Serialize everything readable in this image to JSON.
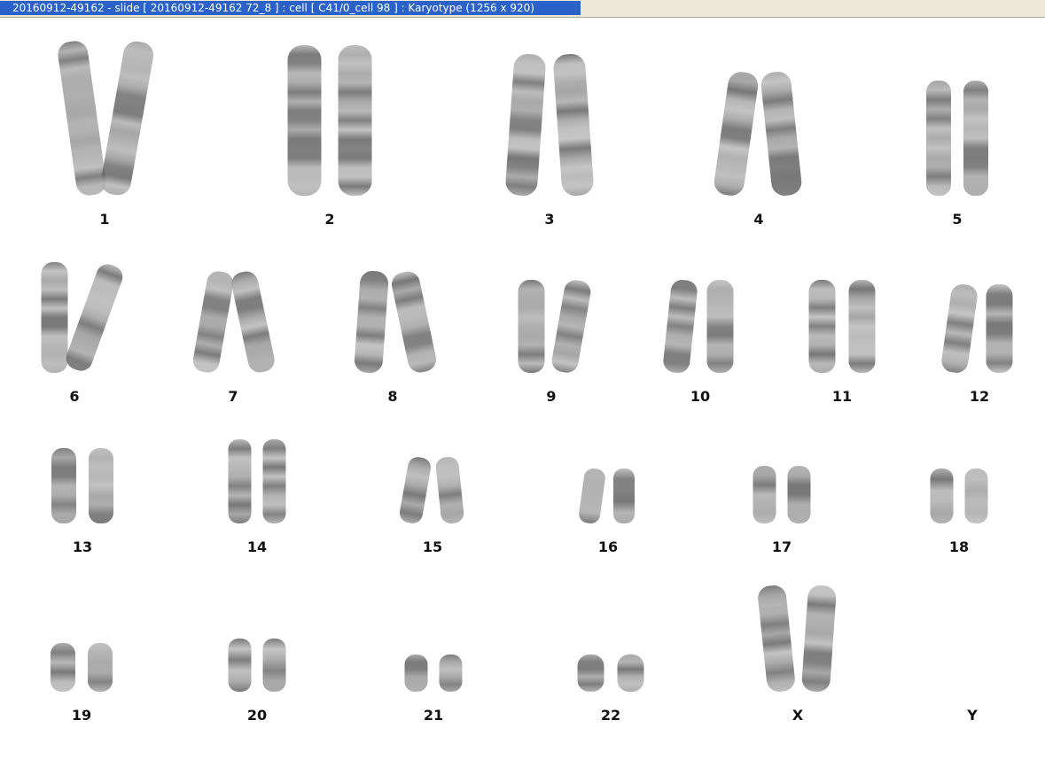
{
  "window": {
    "title": "20160912-49162 - slide [ 20160912-49162 72_8 ] : cell [ C41/0_cell 98 ] : Karyotype  (1256 x 920)"
  },
  "karyotype": {
    "chromosomes": [
      {
        "label": "1"
      },
      {
        "label": "2"
      },
      {
        "label": "3"
      },
      {
        "label": "4"
      },
      {
        "label": "5"
      },
      {
        "label": "6"
      },
      {
        "label": "7"
      },
      {
        "label": "8"
      },
      {
        "label": "9"
      },
      {
        "label": "10"
      },
      {
        "label": "11"
      },
      {
        "label": "12"
      },
      {
        "label": "13"
      },
      {
        "label": "14"
      },
      {
        "label": "15"
      },
      {
        "label": "16"
      },
      {
        "label": "17"
      },
      {
        "label": "18"
      },
      {
        "label": "19"
      },
      {
        "label": "20"
      },
      {
        "label": "21"
      },
      {
        "label": "22"
      },
      {
        "label": "X"
      },
      {
        "label": "Y"
      }
    ]
  }
}
